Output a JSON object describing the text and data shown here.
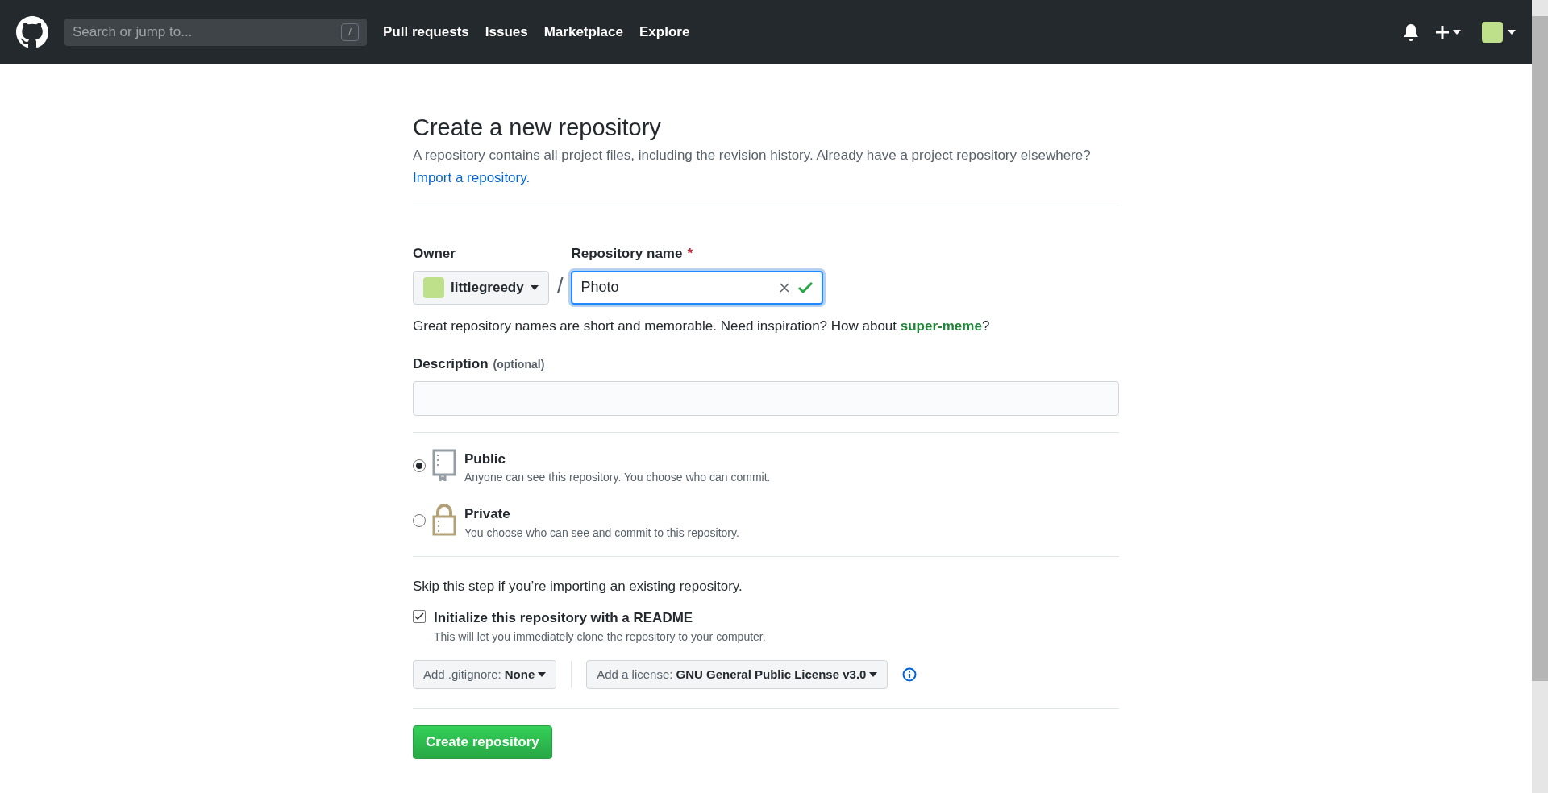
{
  "header": {
    "search": {
      "placeholder": "Search or jump to...",
      "shortcut": "/"
    },
    "nav": [
      "Pull requests",
      "Issues",
      "Marketplace",
      "Explore"
    ]
  },
  "page": {
    "title": "Create a new repository",
    "subtitle": "A repository contains all project files, including the revision history. Already have a project repository elsewhere?",
    "import_link": "Import a repository."
  },
  "owner": {
    "label": "Owner",
    "value": "littlegreedy"
  },
  "separator": "/",
  "repo_name": {
    "label": "Repository name",
    "required_mark": "*",
    "value": "Photo",
    "valid": true
  },
  "hint": "Great repository names are short and memorable. Need inspiration? How about **super-meme**?",
  "description": {
    "label": "Description",
    "optional": "(optional)"
  },
  "visibility": [
    {
      "kind": "book",
      "title": "Public",
      "text": "Anyone can see this repository. You choose who can commit.",
      "selected": true
    },
    {
      "kind": "lock",
      "title": "Private",
      "text": "You choose who can see and commit to this repository.",
      "selected": false
    }
  ],
  "skip_note": "Skip this step if you’re importing an existing repository.",
  "readme": {
    "label": "Initialize this repository with a README",
    "text": "This will let you immediately clone the repository to your computer.",
    "checked": true
  },
  "gitignore": {
    "label": "Add .gitignore:",
    "value": "None"
  },
  "license": {
    "label": "Add a license:",
    "value": "GNU General Public License v3.0"
  },
  "submit": "Create repository"
}
